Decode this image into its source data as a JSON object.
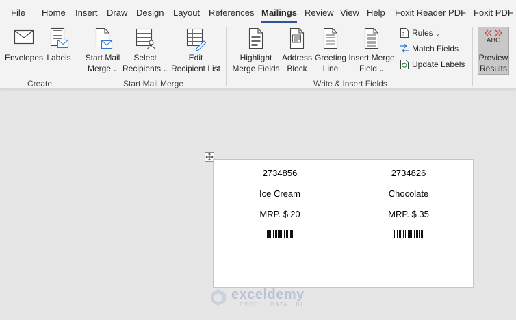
{
  "tabs": [
    {
      "label": "File"
    },
    {
      "label": "Home"
    },
    {
      "label": "Insert"
    },
    {
      "label": "Draw"
    },
    {
      "label": "Design"
    },
    {
      "label": "Layout"
    },
    {
      "label": "References"
    },
    {
      "label": "Mailings",
      "active": true
    },
    {
      "label": "Review"
    },
    {
      "label": "View"
    },
    {
      "label": "Help"
    },
    {
      "label": "Foxit Reader PDF"
    },
    {
      "label": "Foxit PDF"
    }
  ],
  "ribbon": {
    "create": {
      "group_label": "Create",
      "envelopes": "Envelopes",
      "labels": "Labels"
    },
    "start_mail_merge": {
      "group_label": "Start Mail Merge",
      "start_line1": "Start Mail",
      "start_line2": "Merge",
      "select_line1": "Select",
      "select_line2": "Recipients",
      "edit_line1": "Edit",
      "edit_line2": "Recipient List"
    },
    "write_insert": {
      "group_label": "Write & Insert Fields",
      "highlight_line1": "Highlight",
      "highlight_line2": "Merge Fields",
      "address_line1": "Address",
      "address_line2": "Block",
      "greeting_line1": "Greeting",
      "greeting_line2": "Line",
      "insert_line1": "Insert Merge",
      "insert_line2": "Field",
      "rules": "Rules",
      "match_fields": "Match Fields",
      "update_labels": "Update Labels"
    },
    "preview": {
      "icon_text": "ABC",
      "line1": "Preview",
      "line2": "Results"
    }
  },
  "document": {
    "labels": [
      {
        "code": "2734856",
        "name": "Ice Cream",
        "price_prefix": "MRP. $",
        "price_value": "20"
      },
      {
        "code": "2734826",
        "name": "Chocolate",
        "price_prefix": "MRP. $ ",
        "price_value": "35"
      }
    ]
  },
  "watermark": {
    "name": "exceldemy",
    "tagline": "EXCEL · DATA · BI"
  },
  "colors": {
    "accent": "#2b579a",
    "ribbon_bg": "#f3f3f3",
    "canvas_bg": "#e6e6e6",
    "preview_active": "#c8c8c8",
    "chevron_red": "#d83b3b"
  }
}
